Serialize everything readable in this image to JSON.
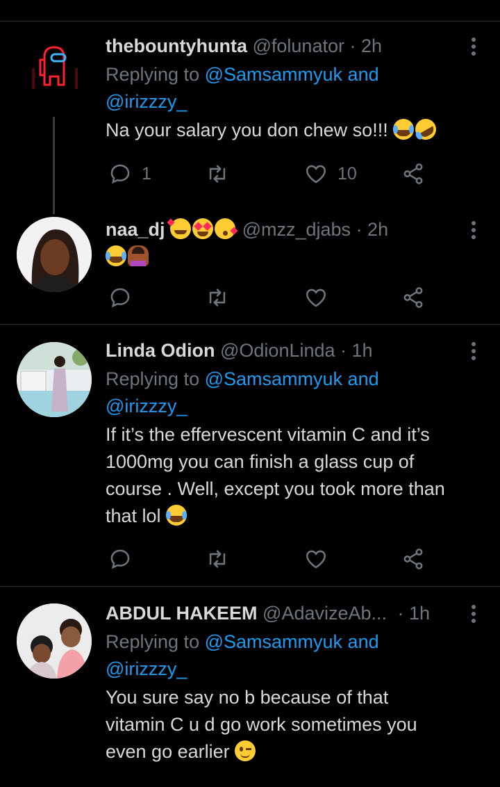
{
  "tweets": [
    {
      "name": "thebountyhunta",
      "handle": "@folunator",
      "time": "· 2h",
      "replying_prefix": "Replying to",
      "replying_users": "@Samsammyuk and",
      "replying_users2": "@irizzzy_",
      "text": "Na your salary you don chew so!!!",
      "reply_count": "1",
      "like_count": "10"
    },
    {
      "name": "naa_dj",
      "handle": "@mzz_djabs",
      "time": "· 2h"
    },
    {
      "name": "Linda Odion",
      "handle": "@OdionLinda",
      "time": "· 1h",
      "replying_prefix": "Replying to",
      "replying_users": "@Samsammyuk and",
      "replying_users2": "@irizzzy_",
      "text_lines": [
        "If it’s the effervescent vitamin C and it’s",
        "1000mg you can finish a glass cup of",
        "course . Well, except you took more than",
        "that lol"
      ]
    },
    {
      "name": "ABDUL HAKEEM",
      "handle": "@AdavizeAb...",
      "time": "· 1h",
      "replying_prefix": "Replying to",
      "replying_users": "@Samsammyuk and",
      "replying_users2": "@irizzzy_",
      "text_lines": [
        "You sure say no b because of that",
        "vitamin C u d go work sometimes you",
        "even go earlier"
      ]
    }
  ],
  "colors": {
    "background": "#000000",
    "text": "#d9d9d9",
    "muted": "#6e767d",
    "link": "#1d9bf0",
    "separator": "#2f3336"
  },
  "icons": [
    "more-icon",
    "reply-icon",
    "retweet-icon",
    "like-icon",
    "share-icon"
  ]
}
